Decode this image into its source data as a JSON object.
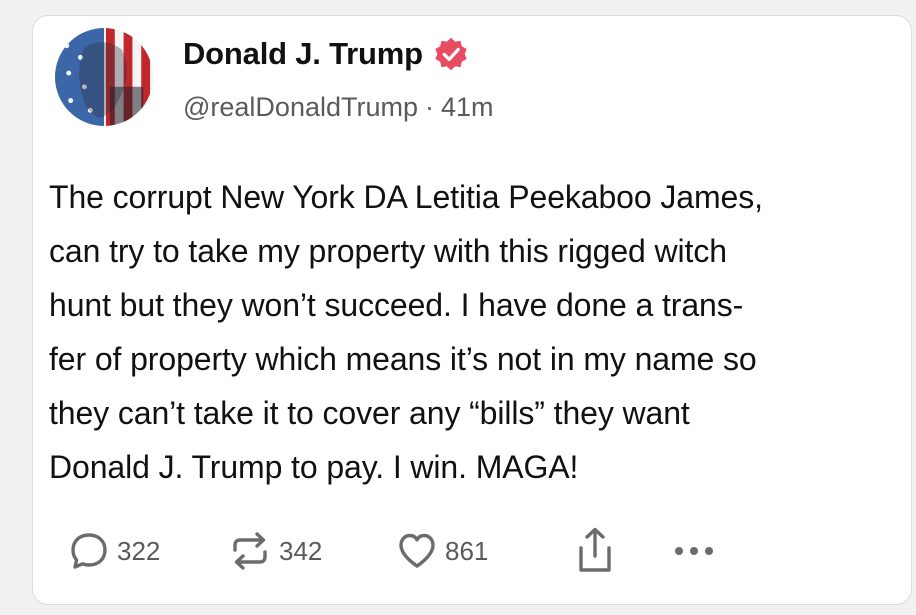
{
  "post": {
    "author": {
      "display_name": "Donald J. Trump",
      "handle": "@realDonaldTrump",
      "verified": true,
      "verified_color": "#e74c62"
    },
    "separator": "·",
    "timestamp": "41m",
    "body_lines": [
      "The corrupt New York DA Letitia Peekaboo James,",
      "can try to take my property with this rigged witch",
      "hunt but they won’t succeed. I have done a trans-",
      "fer of property which means it’s not in my name so",
      "they can’t take it to cover any “bills” they want",
      "Donald J. Trump to pay. I win. MAGA!"
    ],
    "actions": {
      "reply": {
        "icon": "reply-icon",
        "count": "322"
      },
      "repost": {
        "icon": "repost-icon",
        "count": "342"
      },
      "like": {
        "icon": "heart-icon",
        "count": "861"
      },
      "share": {
        "icon": "share-icon"
      },
      "more": {
        "icon": "more-icon"
      }
    }
  },
  "colors": {
    "text": "#111111",
    "muted": "#5a5a5a",
    "icon": "#6b6b6b",
    "card_border": "#dcdcdc"
  }
}
